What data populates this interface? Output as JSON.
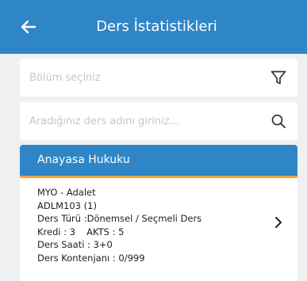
{
  "header": {
    "title": "Ders İstatistikleri",
    "back_icon": "arrow-left-icon"
  },
  "filters": {
    "section_placeholder": "Bölüm seçiniz",
    "section_icon": "filter-icon",
    "search_placeholder": "Aradığınız ders adını giriniz...",
    "search_icon": "search-icon"
  },
  "course": {
    "name": "Anayasa Hukuku",
    "program": "MYO - Adalet",
    "code": "ADLM103 (1)",
    "type_label": "Ders Türü :",
    "type_value": "Dönemsel / Seçmeli Ders",
    "credit_label": "Kredi : ",
    "credit_value": "3",
    "akts_label": "AKTS : ",
    "akts_value": "5",
    "hours_label": "Ders Saati : ",
    "hours_value": "3+0",
    "quota_label": "Ders Kontenjanı : ",
    "quota_value": "0/999",
    "chevron_icon": "chevron-right-icon"
  },
  "colors": {
    "primary": "#2f86c6",
    "accent": "#f3a43b",
    "background": "#eef0f2"
  }
}
